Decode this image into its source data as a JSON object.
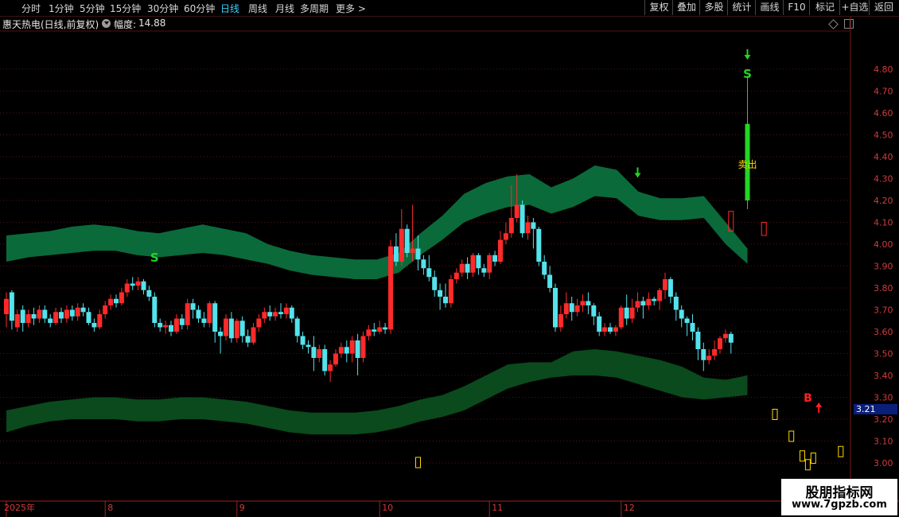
{
  "toolbar": {
    "periods": [
      "分时",
      "1分钟",
      "5分钟",
      "15分钟",
      "30分钟",
      "60分钟",
      "日线",
      "周线",
      "月线",
      "多周期",
      "更多 >"
    ],
    "active_period": "日线",
    "buttons": [
      "复权",
      "叠加",
      "多股",
      "统计",
      "画线",
      "F10",
      "标记",
      "+自选",
      "返回"
    ]
  },
  "header": {
    "title": "惠天热电(日线,前复权)",
    "amplitude_label": "幅度:",
    "amplitude_value": "14.88"
  },
  "current_price_badge": "3.21",
  "watermark": {
    "title": "股朋指标网",
    "url": "www.7gpzb.com"
  },
  "colors": {
    "up_candle": "#ff2a2a",
    "down_candle": "#54e3ec",
    "upper_band": "#0b6a3a",
    "lower_band": "#0a4a1c",
    "signal_green": "#22d622",
    "signal_red": "#ff2020",
    "marker_yellow": "#ffd800",
    "axis_text": "#d23b3b",
    "grid": "#5a1010"
  },
  "signals": {
    "sell_letter": "S",
    "buy_letter": "B",
    "sell_text": "卖出"
  },
  "chart_data": {
    "type": "candlestick",
    "y_axis": {
      "ticks": [
        3.0,
        3.1,
        3.2,
        3.3,
        3.4,
        3.5,
        3.6,
        3.7,
        3.8,
        3.9,
        4.0,
        4.1,
        4.2,
        4.3,
        4.4,
        4.5,
        4.6,
        4.7,
        4.8
      ],
      "labels": [
        "3.00",
        "3.10",
        "3.20",
        "3.30",
        "3.40",
        "3.50",
        "3.60",
        "3.70",
        "3.80",
        "3.90",
        "4.00",
        "4.10",
        "4.20",
        "4.30",
        "4.40",
        "4.50",
        "4.60",
        "4.70",
        "4.80"
      ]
    },
    "x_axis": {
      "labels": [
        "2025年",
        "8",
        "9",
        "10",
        "11",
        "12"
      ],
      "label_index": [
        0,
        18,
        42,
        68,
        88,
        112
      ]
    },
    "candles": [
      [
        3.68,
        3.75,
        3.62,
        3.78
      ],
      [
        3.78,
        3.65,
        3.61,
        3.79
      ],
      [
        3.62,
        3.68,
        3.6,
        3.7
      ],
      [
        3.7,
        3.64,
        3.6,
        3.72
      ],
      [
        3.64,
        3.68,
        3.62,
        3.7
      ],
      [
        3.68,
        3.66,
        3.63,
        3.71
      ],
      [
        3.66,
        3.7,
        3.64,
        3.72
      ],
      [
        3.7,
        3.66,
        3.64,
        3.72
      ],
      [
        3.66,
        3.64,
        3.62,
        3.68
      ],
      [
        3.64,
        3.69,
        3.63,
        3.71
      ],
      [
        3.69,
        3.66,
        3.64,
        3.71
      ],
      [
        3.66,
        3.7,
        3.64,
        3.72
      ],
      [
        3.7,
        3.67,
        3.65,
        3.72
      ],
      [
        3.67,
        3.71,
        3.65,
        3.73
      ],
      [
        3.71,
        3.69,
        3.67,
        3.73
      ],
      [
        3.69,
        3.64,
        3.63,
        3.71
      ],
      [
        3.64,
        3.62,
        3.6,
        3.66
      ],
      [
        3.62,
        3.68,
        3.61,
        3.7
      ],
      [
        3.68,
        3.72,
        3.66,
        3.74
      ],
      [
        3.72,
        3.75,
        3.7,
        3.77
      ],
      [
        3.75,
        3.73,
        3.71,
        3.77
      ],
      [
        3.73,
        3.78,
        3.72,
        3.8
      ],
      [
        3.78,
        3.82,
        3.76,
        3.84
      ],
      [
        3.82,
        3.81,
        3.79,
        3.85
      ],
      [
        3.81,
        3.83,
        3.79,
        3.85
      ],
      [
        3.83,
        3.79,
        3.77,
        3.84
      ],
      [
        3.79,
        3.76,
        3.74,
        3.81
      ],
      [
        3.76,
        3.64,
        3.62,
        3.78
      ],
      [
        3.64,
        3.62,
        3.6,
        3.66
      ],
      [
        3.62,
        3.63,
        3.59,
        3.65
      ],
      [
        3.63,
        3.6,
        3.58,
        3.65
      ],
      [
        3.6,
        3.66,
        3.59,
        3.68
      ],
      [
        3.66,
        3.63,
        3.61,
        3.68
      ],
      [
        3.63,
        3.73,
        3.61,
        3.75
      ],
      [
        3.73,
        3.7,
        3.66,
        3.75
      ],
      [
        3.7,
        3.66,
        3.64,
        3.72
      ],
      [
        3.66,
        3.64,
        3.62,
        3.69
      ],
      [
        3.64,
        3.73,
        3.62,
        3.74
      ],
      [
        3.73,
        3.6,
        3.55,
        3.74
      ],
      [
        3.6,
        3.58,
        3.5,
        3.62
      ],
      [
        3.58,
        3.66,
        3.56,
        3.68
      ],
      [
        3.66,
        3.57,
        3.55,
        3.69
      ],
      [
        3.57,
        3.65,
        3.55,
        3.66
      ],
      [
        3.65,
        3.58,
        3.55,
        3.67
      ],
      [
        3.58,
        3.55,
        3.53,
        3.61
      ],
      [
        3.55,
        3.62,
        3.54,
        3.64
      ],
      [
        3.62,
        3.66,
        3.6,
        3.68
      ],
      [
        3.66,
        3.69,
        3.64,
        3.71
      ],
      [
        3.69,
        3.67,
        3.65,
        3.72
      ],
      [
        3.67,
        3.69,
        3.65,
        3.71
      ],
      [
        3.69,
        3.68,
        3.66,
        3.73
      ],
      [
        3.68,
        3.71,
        3.66,
        3.73
      ],
      [
        3.71,
        3.66,
        3.64,
        3.72
      ],
      [
        3.66,
        3.58,
        3.55,
        3.67
      ],
      [
        3.58,
        3.54,
        3.52,
        3.6
      ],
      [
        3.54,
        3.53,
        3.5,
        3.56
      ],
      [
        3.53,
        3.48,
        3.42,
        3.58
      ],
      [
        3.48,
        3.52,
        3.46,
        3.54
      ],
      [
        3.52,
        3.42,
        3.4,
        3.54
      ],
      [
        3.42,
        3.45,
        3.37,
        3.47
      ],
      [
        3.45,
        3.5,
        3.44,
        3.52
      ],
      [
        3.5,
        3.53,
        3.48,
        3.55
      ],
      [
        3.53,
        3.5,
        3.46,
        3.56
      ],
      [
        3.5,
        3.56,
        3.46,
        3.58
      ],
      [
        3.56,
        3.48,
        3.4,
        3.59
      ],
      [
        3.48,
        3.58,
        3.46,
        3.6
      ],
      [
        3.58,
        3.61,
        3.56,
        3.63
      ],
      [
        3.61,
        3.6,
        3.58,
        3.64
      ],
      [
        3.6,
        3.62,
        3.59,
        3.65
      ],
      [
        3.62,
        3.61,
        3.59,
        3.64
      ],
      [
        3.61,
        3.99,
        3.59,
        4.02
      ],
      [
        3.99,
        3.92,
        3.9,
        4.05
      ],
      [
        3.92,
        4.07,
        3.9,
        4.16
      ],
      [
        4.07,
        3.96,
        3.94,
        4.09
      ],
      [
        3.96,
        3.98,
        3.92,
        4.18
      ],
      [
        3.98,
        3.93,
        3.88,
        4.04
      ],
      [
        3.93,
        3.89,
        3.86,
        3.95
      ],
      [
        3.89,
        3.85,
        3.83,
        3.95
      ],
      [
        3.85,
        3.79,
        3.76,
        3.88
      ],
      [
        3.79,
        3.76,
        3.7,
        3.82
      ],
      [
        3.76,
        3.73,
        3.71,
        3.82
      ],
      [
        3.73,
        3.84,
        3.71,
        3.86
      ],
      [
        3.84,
        3.87,
        3.82,
        3.89
      ],
      [
        3.87,
        3.91,
        3.85,
        3.93
      ],
      [
        3.91,
        3.87,
        3.84,
        3.94
      ],
      [
        3.87,
        3.95,
        3.85,
        3.96
      ],
      [
        3.95,
        3.89,
        3.86,
        3.96
      ],
      [
        3.89,
        3.87,
        3.85,
        3.91
      ],
      [
        3.87,
        3.95,
        3.84,
        3.96
      ],
      [
        3.95,
        3.92,
        3.9,
        3.97
      ],
      [
        3.92,
        4.02,
        3.91,
        4.06
      ],
      [
        4.02,
        4.05,
        4.0,
        4.1
      ],
      [
        4.05,
        4.12,
        4.03,
        4.27
      ],
      [
        4.12,
        4.18,
        4.1,
        4.32
      ],
      [
        4.18,
        4.05,
        4.03,
        4.2
      ],
      [
        4.05,
        4.1,
        4.02,
        4.13
      ],
      [
        4.1,
        4.07,
        3.98,
        4.12
      ],
      [
        4.07,
        3.92,
        3.9,
        4.08
      ],
      [
        3.92,
        3.86,
        3.84,
        3.95
      ],
      [
        3.86,
        3.8,
        3.78,
        3.9
      ],
      [
        3.8,
        3.62,
        3.6,
        3.82
      ],
      [
        3.62,
        3.68,
        3.6,
        3.72
      ],
      [
        3.68,
        3.73,
        3.66,
        3.78
      ],
      [
        3.73,
        3.69,
        3.65,
        3.76
      ],
      [
        3.69,
        3.72,
        3.67,
        3.75
      ],
      [
        3.72,
        3.74,
        3.69,
        3.77
      ],
      [
        3.74,
        3.72,
        3.68,
        3.78
      ],
      [
        3.72,
        3.67,
        3.63,
        3.73
      ],
      [
        3.67,
        3.6,
        3.58,
        3.69
      ],
      [
        3.6,
        3.62,
        3.58,
        3.64
      ],
      [
        3.62,
        3.6,
        3.59,
        3.64
      ],
      [
        3.6,
        3.62,
        3.58,
        3.63
      ],
      [
        3.62,
        3.71,
        3.61,
        3.72
      ],
      [
        3.71,
        3.66,
        3.63,
        3.77
      ],
      [
        3.66,
        3.71,
        3.64,
        3.75
      ],
      [
        3.71,
        3.74,
        3.69,
        3.78
      ],
      [
        3.74,
        3.72,
        3.66,
        3.76
      ],
      [
        3.72,
        3.75,
        3.7,
        3.78
      ],
      [
        3.75,
        3.74,
        3.72,
        3.76
      ],
      [
        3.74,
        3.79,
        3.7,
        3.8
      ],
      [
        3.79,
        3.84,
        3.75,
        3.87
      ],
      [
        3.84,
        3.76,
        3.73,
        3.85
      ],
      [
        3.76,
        3.7,
        3.65,
        3.78
      ],
      [
        3.7,
        3.66,
        3.62,
        3.72
      ],
      [
        3.66,
        3.64,
        3.58,
        3.67
      ],
      [
        3.64,
        3.6,
        3.56,
        3.68
      ],
      [
        3.6,
        3.52,
        3.47,
        3.62
      ],
      [
        3.52,
        3.47,
        3.42,
        3.55
      ],
      [
        3.47,
        3.49,
        3.45,
        3.52
      ],
      [
        3.49,
        3.52,
        3.47,
        3.56
      ],
      [
        3.52,
        3.57,
        3.5,
        3.58
      ],
      [
        3.57,
        3.59,
        3.55,
        3.61
      ],
      [
        3.59,
        3.55,
        3.5,
        3.6
      ]
    ],
    "candles_format": "[open, close, low, high]",
    "bands": {
      "upper": {
        "top": [
          4.04,
          4.05,
          4.06,
          4.08,
          4.09,
          4.08,
          4.06,
          4.05,
          4.07,
          4.09,
          4.07,
          4.05,
          4.0,
          3.97,
          3.95,
          3.94,
          3.93,
          3.93,
          3.96,
          4.05,
          4.13,
          4.23,
          4.28,
          4.31,
          4.32,
          4.26,
          4.3,
          4.36,
          4.34,
          4.24,
          4.21,
          4.21,
          4.22,
          4.1,
          3.98
        ],
        "bottom": [
          3.92,
          3.94,
          3.95,
          3.96,
          3.97,
          3.97,
          3.95,
          3.94,
          3.95,
          3.96,
          3.95,
          3.93,
          3.91,
          3.88,
          3.86,
          3.85,
          3.84,
          3.84,
          3.87,
          3.95,
          4.02,
          4.1,
          4.14,
          4.17,
          4.18,
          4.14,
          4.17,
          4.22,
          4.21,
          4.13,
          4.11,
          4.11,
          4.12,
          4.0,
          3.91
        ]
      },
      "lower": {
        "top": [
          3.24,
          3.26,
          3.28,
          3.29,
          3.3,
          3.3,
          3.29,
          3.29,
          3.3,
          3.3,
          3.29,
          3.28,
          3.26,
          3.24,
          3.23,
          3.23,
          3.23,
          3.24,
          3.26,
          3.29,
          3.31,
          3.35,
          3.4,
          3.45,
          3.46,
          3.46,
          3.51,
          3.52,
          3.51,
          3.49,
          3.47,
          3.44,
          3.39,
          3.38,
          3.4
        ],
        "bottom": [
          3.14,
          3.17,
          3.19,
          3.2,
          3.2,
          3.2,
          3.19,
          3.19,
          3.2,
          3.2,
          3.19,
          3.18,
          3.16,
          3.14,
          3.13,
          3.13,
          3.13,
          3.14,
          3.16,
          3.19,
          3.21,
          3.24,
          3.29,
          3.34,
          3.37,
          3.39,
          3.4,
          3.4,
          3.39,
          3.36,
          3.33,
          3.3,
          3.29,
          3.3,
          3.31
        ]
      }
    },
    "band_x_range": [
      0,
      135
    ],
    "yellow_markers": [
      [
        75,
        3.0
      ],
      [
        140,
        3.22
      ],
      [
        143,
        3.12
      ],
      [
        145,
        3.03
      ],
      [
        146,
        2.99
      ],
      [
        147,
        3.02
      ],
      [
        152,
        3.05
      ]
    ],
    "sell_letters": [
      [
        27,
        3.92
      ],
      [
        135,
        4.76
      ]
    ],
    "buy_letters": [
      [
        146,
        3.28
      ]
    ],
    "down_arrows": [
      [
        115,
        4.34
      ],
      [
        135,
        4.88
      ]
    ],
    "up_arrows": [
      [
        148,
        3.24
      ]
    ],
    "sell_text_pos": [
      135,
      4.35
    ],
    "big_green_candle": {
      "index": 135,
      "open": 4.55,
      "close": 4.2,
      "low": 4.16,
      "high": 4.77
    },
    "extra_open_candles": [
      [
        132,
        4.15,
        4.06,
        4.06,
        4.15
      ],
      [
        138,
        4.1,
        4.04,
        4.04,
        4.12
      ]
    ]
  }
}
